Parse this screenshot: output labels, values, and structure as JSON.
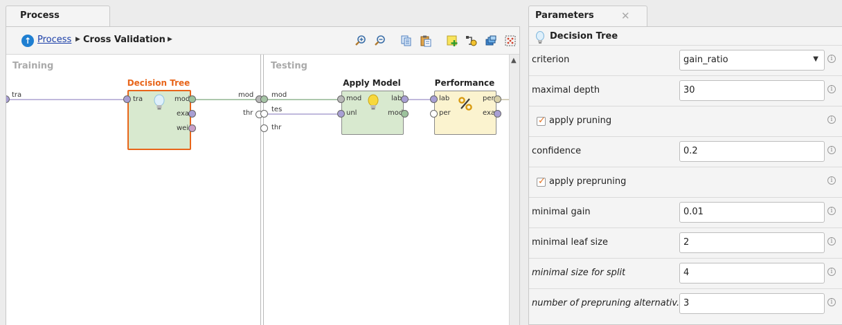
{
  "process": {
    "tab_label": "Process",
    "breadcrumb": {
      "root": "Process",
      "current": "Cross Validation"
    },
    "toolbar_icons": [
      "zoom-in-icon",
      "zoom-out-icon",
      "copy-icon",
      "paste-icon",
      "add-note-icon",
      "auto-wire-icon",
      "layers-icon",
      "fit-grid-icon"
    ],
    "subprocesses": {
      "training": "Training",
      "testing": "Testing"
    },
    "outer_ports": {
      "training_in": "tra",
      "training_out": [
        "mod",
        "thr"
      ],
      "testing_in": [
        "mod",
        "tes",
        "thr"
      ]
    },
    "operators": {
      "decision_tree": {
        "title": "Decision Tree",
        "in_ports": [
          "tra"
        ],
        "out_ports": [
          "mod",
          "exa",
          "wei"
        ],
        "icon": "lightbulb-icon",
        "title_color": "#e8651a"
      },
      "apply_model": {
        "title": "Apply Model",
        "in_ports": [
          "mod",
          "unl"
        ],
        "out_ports": [
          "lab",
          "mod"
        ],
        "icon": "lightbulb-icon"
      },
      "performance": {
        "title": "Performance",
        "in_ports": [
          "lab",
          "per"
        ],
        "out_ports": [
          "per",
          "exa"
        ],
        "icon": "percent-icon"
      }
    }
  },
  "parameters": {
    "tab_label": "Parameters",
    "operator_title": "Decision Tree",
    "rows": [
      {
        "label": "criterion",
        "type": "select",
        "value": "gain_ratio"
      },
      {
        "label": "maximal depth",
        "type": "text",
        "value": "30"
      },
      {
        "label": "apply pruning",
        "type": "checkbox",
        "checked": true
      },
      {
        "label": "confidence",
        "type": "text",
        "value": "0.2"
      },
      {
        "label": "apply prepruning",
        "type": "checkbox",
        "checked": true
      },
      {
        "label": "minimal gain",
        "type": "text",
        "value": "0.01"
      },
      {
        "label": "minimal leaf size",
        "type": "text",
        "value": "2"
      },
      {
        "label": "minimal size for split",
        "type": "text",
        "value": "4",
        "italic": true
      },
      {
        "label": "number of prepruning alternativ...",
        "type": "text",
        "value": "3",
        "italic": true
      }
    ]
  },
  "colors": {
    "model_wire": "#7aa87a",
    "example_wire": "#9a8fc8",
    "decision_tree_fill": "#d8e9cf",
    "decision_tree_border": "#e8651a",
    "apply_model_fill": "#d8e9cf",
    "performance_fill": "#fbf3cf",
    "checkbox_mark": "#e4701e",
    "link": "#1a3ea8"
  }
}
